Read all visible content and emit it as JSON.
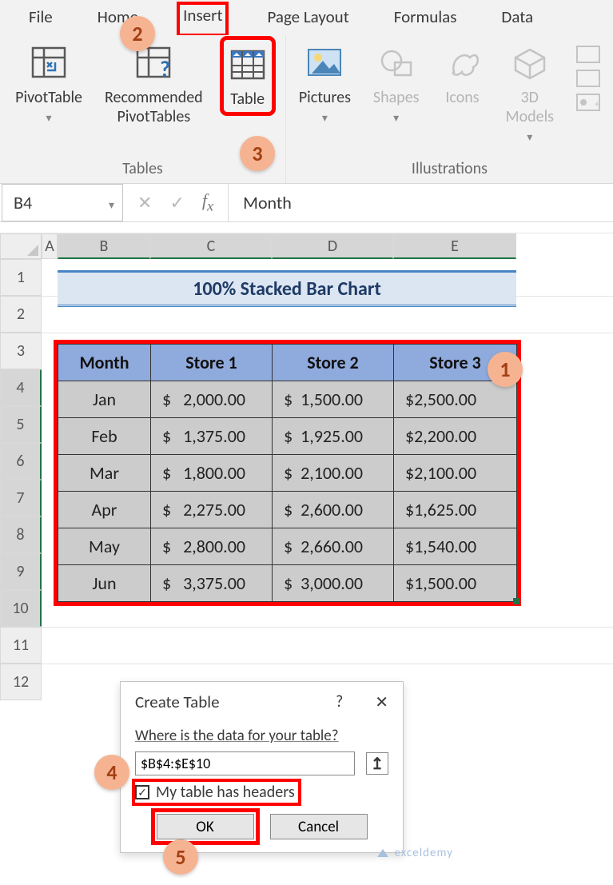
{
  "tabs": {
    "file": "File",
    "home": "Home",
    "insert": "Insert",
    "pagelayout": "Page Layout",
    "formulas": "Formulas",
    "data": "Data"
  },
  "ribbon": {
    "pivottable": "PivotTable",
    "recommended": "Recommended\nPivotTables",
    "table": "Table",
    "pictures": "Pictures",
    "shapes": "Shapes",
    "icons": "Icons",
    "models3d": "3D\nModels",
    "grp_tables": "Tables",
    "grp_illus": "Illustrations"
  },
  "steps": {
    "s1": "1",
    "s2": "2",
    "s3": "3",
    "s4": "4",
    "s5": "5"
  },
  "namebox": "B4",
  "fxvalue": "Month",
  "colheaders": {
    "A": "A",
    "B": "B",
    "C": "C",
    "D": "D",
    "E": "E"
  },
  "rowheaders": [
    "1",
    "2",
    "3",
    "4",
    "5",
    "6",
    "7",
    "8",
    "9",
    "10",
    "11",
    "12"
  ],
  "title": "100% Stacked Bar Chart",
  "table": {
    "headers": [
      "Month",
      "Store 1",
      "Store 2",
      "Store 3"
    ],
    "rows": [
      [
        "Jan",
        "$   2,000.00",
        "$  1,500.00",
        "$2,500.00"
      ],
      [
        "Feb",
        "$   1,375.00",
        "$  1,925.00",
        "$2,200.00"
      ],
      [
        "Mar",
        "$   1,800.00",
        "$  2,100.00",
        "$2,100.00"
      ],
      [
        "Apr",
        "$   2,275.00",
        "$  2,600.00",
        "$1,625.00"
      ],
      [
        "May",
        "$   2,800.00",
        "$  2,660.00",
        "$1,540.00"
      ],
      [
        "Jun",
        "$   3,375.00",
        "$  3,000.00",
        "$1,500.00"
      ]
    ]
  },
  "dialog": {
    "title": "Create Table",
    "help": "?",
    "close": "✕",
    "prompt": "Where is the data for your table?",
    "range": "$B$4:$E$10",
    "pick": "↥",
    "checkbox": "My table has headers",
    "check_mark": "✓",
    "ok": "OK",
    "cancel": "Cancel"
  },
  "chart_data": {
    "type": "table",
    "title": "100% Stacked Bar Chart",
    "columns": [
      "Month",
      "Store 1",
      "Store 2",
      "Store 3"
    ],
    "series": [
      {
        "name": "Store 1",
        "values": [
          2000.0,
          1375.0,
          1800.0,
          2275.0,
          2800.0,
          3375.0
        ]
      },
      {
        "name": "Store 2",
        "values": [
          1500.0,
          1925.0,
          2100.0,
          2600.0,
          2660.0,
          3000.0
        ]
      },
      {
        "name": "Store 3",
        "values": [
          2500.0,
          2200.0,
          2100.0,
          1625.0,
          1540.0,
          1500.0
        ]
      }
    ],
    "categories": [
      "Jan",
      "Feb",
      "Mar",
      "Apr",
      "May",
      "Jun"
    ]
  },
  "watermark": "exceldemy"
}
